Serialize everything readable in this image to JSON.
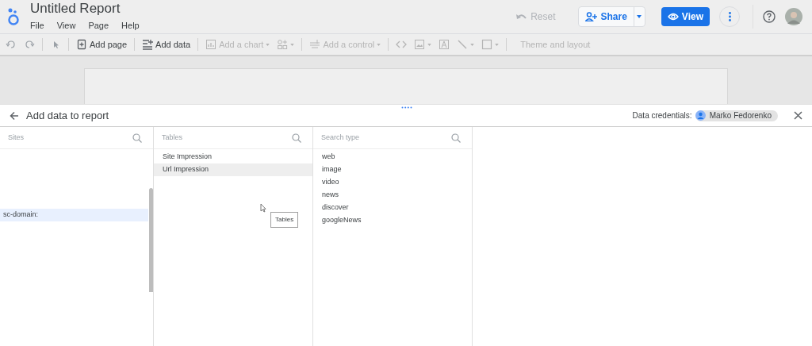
{
  "report": {
    "title": "Untitled Report",
    "menu": [
      "File",
      "View",
      "Page",
      "Help"
    ]
  },
  "header_buttons": {
    "reset": {
      "label": "Reset",
      "disabled": true
    },
    "share": "Share",
    "view": "View"
  },
  "toolbar": [
    {
      "kind": "undo"
    },
    {
      "kind": "redo"
    },
    {
      "kind": "sep"
    },
    {
      "kind": "select"
    },
    {
      "kind": "sep"
    },
    {
      "kind": "page",
      "label": "Add page",
      "disabled": false
    },
    {
      "kind": "sep"
    },
    {
      "kind": "data",
      "label": "Add data",
      "disabled": false
    },
    {
      "kind": "sep"
    },
    {
      "kind": "chart",
      "label": "Add a chart",
      "disabled": true
    },
    {
      "kind": "viz"
    },
    {
      "kind": "sep"
    },
    {
      "kind": "control",
      "label": "Add a control",
      "disabled": true
    },
    {
      "kind": "sep"
    },
    {
      "kind": "code"
    },
    {
      "kind": "image"
    },
    {
      "kind": "text"
    },
    {
      "kind": "line"
    },
    {
      "kind": "shape"
    },
    {
      "kind": "sep"
    },
    {
      "kind": "theme",
      "label": "Theme and layout",
      "disabled": true
    }
  ],
  "panel": {
    "title": "Add data to report",
    "credentials_label": "Data credentials:",
    "credentials_user": "Marko Fedorenko",
    "columns": [
      {
        "placeholder": "Sites",
        "items": [
          {
            "label": "sc-domain:",
            "selected": true
          }
        ]
      },
      {
        "placeholder": "Tables",
        "items": [
          {
            "label": "Site Impression",
            "selected": false
          },
          {
            "label": "Url Impression",
            "selected": true
          }
        ]
      },
      {
        "placeholder": "Search type",
        "items": [
          {
            "label": "web",
            "selected": false
          },
          {
            "label": "image",
            "selected": false
          },
          {
            "label": "video",
            "selected": false
          },
          {
            "label": "news",
            "selected": false
          },
          {
            "label": "discover",
            "selected": false
          },
          {
            "label": "googleNews",
            "selected": false
          }
        ]
      }
    ]
  },
  "tooltip": "Tables"
}
